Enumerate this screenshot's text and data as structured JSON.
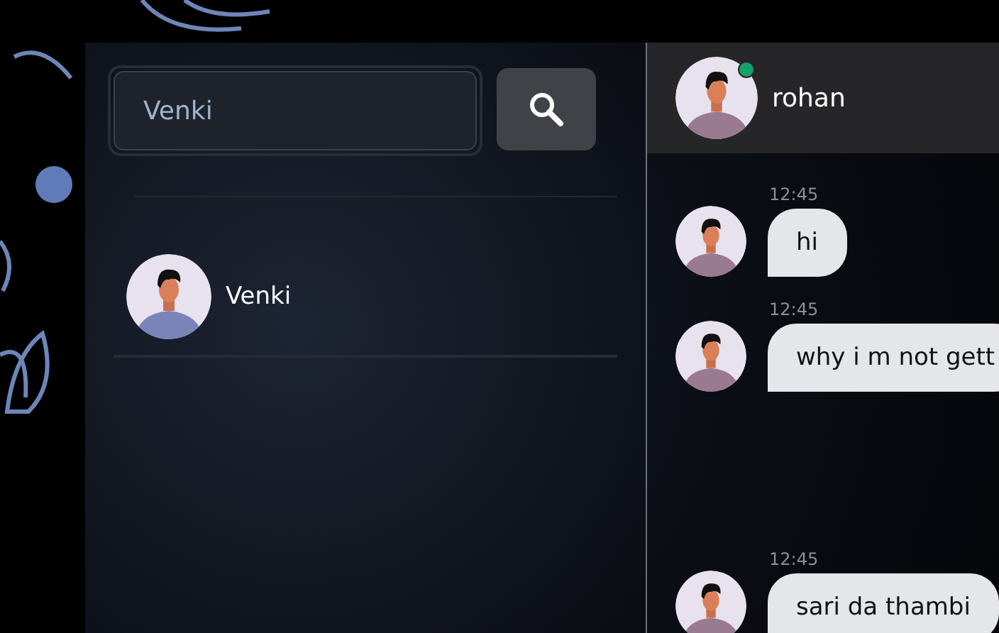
{
  "search": {
    "value": "Venki"
  },
  "contacts": [
    {
      "name": "Venki"
    }
  ],
  "chat": {
    "contact": {
      "name": "rohan",
      "online": true
    },
    "messages": [
      {
        "time": "12:45",
        "text": "hi"
      },
      {
        "time": "12:45",
        "text": "why i m not gett"
      },
      {
        "time": "12:45",
        "text": "sari da thambi"
      }
    ]
  }
}
